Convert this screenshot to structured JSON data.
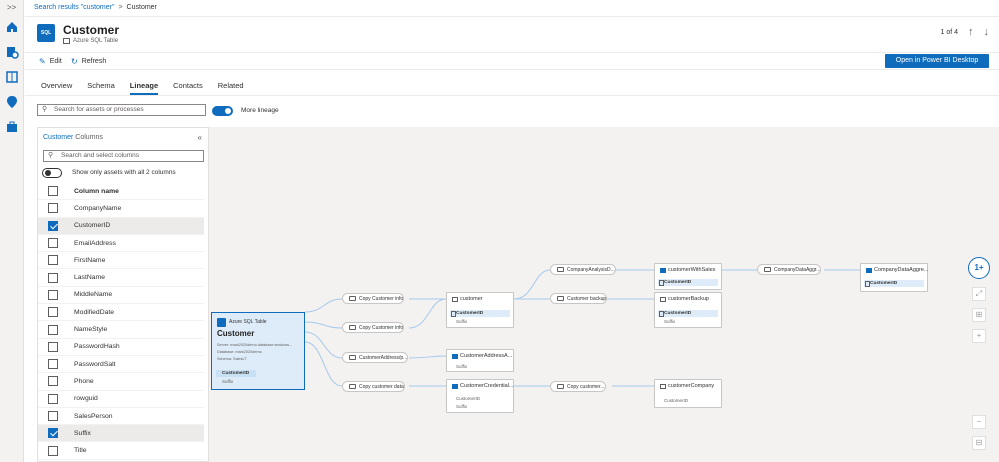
{
  "breadcrumb": {
    "search_link": "Search results \"customer\"",
    "separator": ">",
    "current": "Customer"
  },
  "rail": {
    "expand_label": ">>",
    "icons": [
      "home-icon",
      "catalog-icon",
      "glossary-icon",
      "insights-icon",
      "management-icon"
    ]
  },
  "header": {
    "icon_text": "SQL",
    "title": "Customer",
    "asset_type": "Azure SQL Table"
  },
  "pager": {
    "position": "1 of 4",
    "up": "↑",
    "down": "↓"
  },
  "commands": {
    "edit": "Edit",
    "refresh": "Refresh",
    "open_pbi": "Open in Power BI Desktop"
  },
  "tabs": [
    {
      "label": "Overview"
    },
    {
      "label": "Schema"
    },
    {
      "label": "Lineage",
      "active": true
    },
    {
      "label": "Contacts"
    },
    {
      "label": "Related"
    }
  ],
  "lineage_search": {
    "placeholder": "Search for assets or processes"
  },
  "more_lineage": {
    "label": "More lineage",
    "on": true
  },
  "columns_panel": {
    "title_asset": "Customer",
    "title_suffix": "Columns",
    "collapse": "«",
    "search_placeholder": "Search and select columns",
    "toggle_label": "Show only assets with all 2 columns",
    "header": "Column name",
    "columns": [
      {
        "name": "CompanyName",
        "checked": false
      },
      {
        "name": "CustomerID",
        "checked": true
      },
      {
        "name": "EmailAddress",
        "checked": false
      },
      {
        "name": "FirstName",
        "checked": false
      },
      {
        "name": "LastName",
        "checked": false
      },
      {
        "name": "MiddleName",
        "checked": false
      },
      {
        "name": "ModifiedDate",
        "checked": false
      },
      {
        "name": "NameStyle",
        "checked": false
      },
      {
        "name": "PasswordHash",
        "checked": false
      },
      {
        "name": "PasswordSalt",
        "checked": false
      },
      {
        "name": "Phone",
        "checked": false
      },
      {
        "name": "rowguid",
        "checked": false
      },
      {
        "name": "SalesPerson",
        "checked": false
      },
      {
        "name": "Suffix",
        "checked": true
      },
      {
        "name": "Title",
        "checked": false
      }
    ]
  },
  "lineage": {
    "main": {
      "type": "Azure SQL Table",
      "name": "Customer",
      "meta": [
        "Server: mark2020demo.database.windows...",
        "Database: mark2020demo",
        "Schema: SalesLT"
      ],
      "col1": "CustomerID",
      "col2": "Suffix"
    },
    "processes": {
      "copy_info_1": "Copy Customer info",
      "copy_info_2": "Copy Customer info",
      "cust_address": "CustomerAddress/p...",
      "copy_data": "Copy customer data",
      "company_analysis": "CompanyAnalysisD...",
      "customer_backup": "Customer backup",
      "copy_customer": "Copy customer...",
      "company_data_aggr": "CompanyDataAggr..."
    },
    "assets": {
      "customer": {
        "name": "customer",
        "col1": "CustomerID",
        "col2": "Suffix"
      },
      "cust_address": {
        "name": "CustomerAddressA...",
        "col2": "Suffix"
      },
      "cust_credential": {
        "name": "CustomerCredential...",
        "col1": "CustomerID",
        "col2": "Suffix"
      },
      "with_sales": {
        "name": "customerWithSales",
        "col1": "CustomerID"
      },
      "backup": {
        "name": "customerBackup",
        "col1": "CustomerID",
        "col2": "Suffix"
      },
      "company": {
        "name": "customerCompany",
        "col1": "CustomerID"
      },
      "aggregate": {
        "name": "CompanyDataAggre...",
        "col1": "CustomerID"
      }
    }
  },
  "zoom": {
    "main": "1+",
    "fit": "⤢",
    "center": "⊞",
    "plus": "+",
    "minus": "−",
    "minimap": "⊟"
  }
}
